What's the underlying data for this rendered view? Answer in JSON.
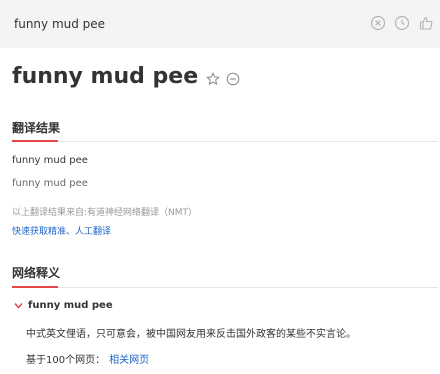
{
  "search": {
    "value": "funny mud pee"
  },
  "icons": {
    "clear": "clear-circle-x-icon",
    "history": "clock-history-icon",
    "like": "thumbs-up-icon",
    "star": "star-icon",
    "more": "more-dots-circle-icon",
    "expand": "chevron-down-icon"
  },
  "word": {
    "title": "funny mud pee"
  },
  "translation": {
    "heading": "翻译结果",
    "result": "funny mud pee",
    "secondary": "funny mud pee",
    "source_note": "以上翻译结果来自:有道神经网络翻译（NMT）",
    "link_fast": "快速获取精准",
    "separator": "、",
    "link_human": "人工翻译"
  },
  "web_meaning": {
    "heading": "网络释义",
    "term": "funny mud pee",
    "description": "中式英文俚语，只可意会，被中国网友用来反击国外政客的某些不实言论。",
    "source_prefix": "基于100个网页：",
    "source_link": "相关网页"
  },
  "colors": {
    "accent": "#e64545",
    "link": "#1b65c9",
    "search_bg": "#f3f4f5"
  }
}
